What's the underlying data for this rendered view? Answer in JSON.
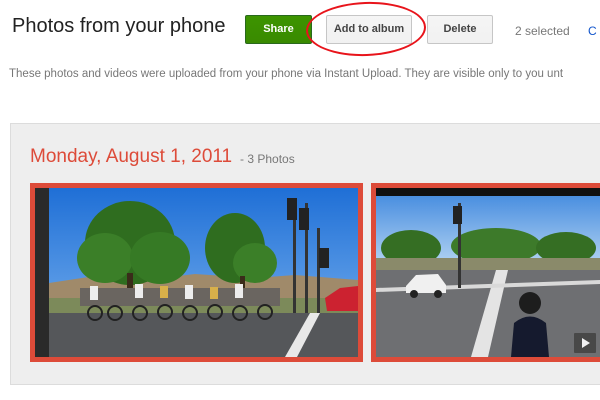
{
  "header": {
    "title": "Photos from your phone",
    "share_label": "Share",
    "add_to_album_label": "Add to album",
    "delete_label": "Delete",
    "selected_text": "2 selected",
    "clear_link_text": "C"
  },
  "info_text": "These photos and videos were uploaded from your phone via Instant Upload. They are visible only to you unt",
  "group": {
    "date": "Monday, August 1, 2011",
    "count": "- 3 Photos"
  },
  "colors": {
    "share_green": "#3d9400",
    "accent_red": "#dd4b39",
    "annotation_red": "#e8141b"
  },
  "thumbnails": [
    {
      "kind": "photo",
      "subject": "cyclists crossing street with traffic lights",
      "selected": true
    },
    {
      "kind": "video",
      "subject": "street intersection with person in foreground",
      "selected": true,
      "icon": "play-icon"
    }
  ]
}
